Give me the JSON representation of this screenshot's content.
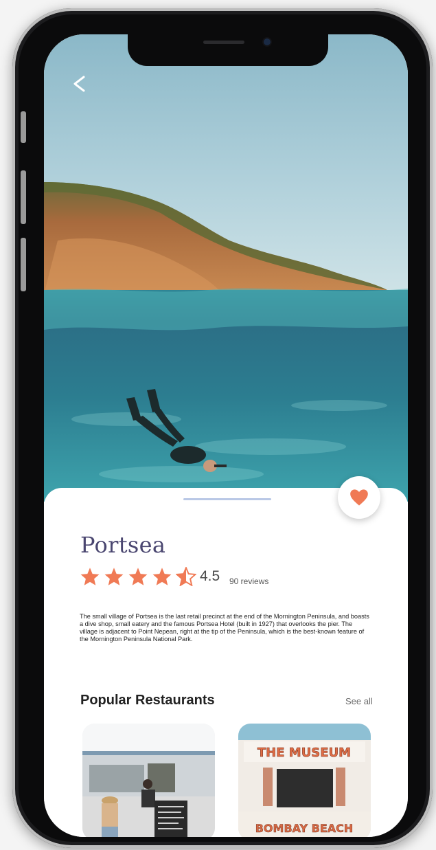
{
  "header": {
    "back_glyph": "<",
    "back_icon": "chevron-left-icon"
  },
  "place": {
    "name": "Portsea",
    "rating_value": "4.5",
    "rating_stars": 4.5,
    "rating_max": 5,
    "reviews_text": "90 reviews",
    "description": "The small village of Portsea is the last retail precinct at the end of the Mornington Peninsula, and boasts a dive shop, small eatery and the famous Portsea Hotel (built in 1927) that overlooks the pier. The village is adjacent to Point Nepean, right at the tip of the Peninsula, which is the best-known feature of the Mornington Peninsula National Park."
  },
  "favorite": {
    "icon": "heart-icon",
    "color": "#f07a55"
  },
  "restaurants_section": {
    "title": "Popular Restaurants",
    "see_all": "See all",
    "cards": [
      {
        "id": "cafe",
        "sign_text": ""
      },
      {
        "id": "museum",
        "sign_top": "THE MUSEUM",
        "sign_bottom": "BOMBAY BEACH"
      }
    ]
  },
  "colors": {
    "accent": "#f07a55",
    "title": "#4a4670",
    "handle": "#b9c8e6"
  }
}
